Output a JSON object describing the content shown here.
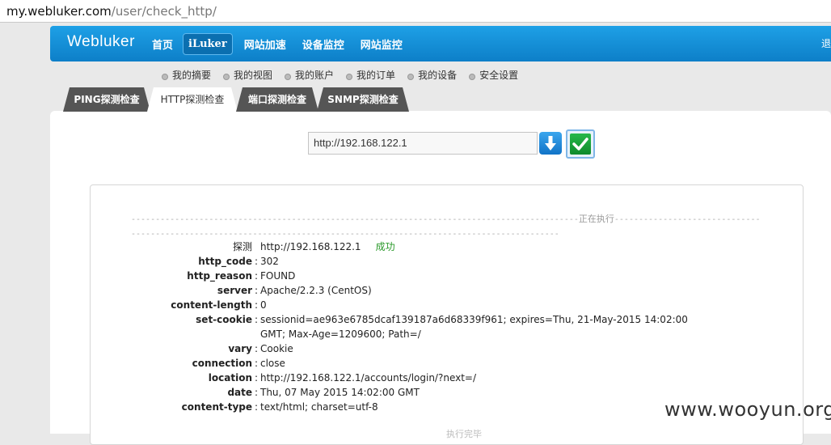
{
  "browser": {
    "url_host": "my.webluker.com",
    "url_path": "/user/check_http/"
  },
  "header": {
    "logo": "Webluker",
    "nav": [
      "首页",
      "iLuker",
      "网站加速",
      "设备监控",
      "网站监控"
    ],
    "active_nav": "iLuker",
    "logout": "退"
  },
  "subnav": [
    "我的摘要",
    "我的视图",
    "我的账户",
    "我的订单",
    "我的设备",
    "安全设置"
  ],
  "tabs": [
    "PING探测检查",
    "HTTP探测检查",
    "端口探测检查",
    "SNMP探测检查"
  ],
  "active_tab": "HTTP探测检查",
  "check": {
    "url_value": "http://192.168.122.1"
  },
  "result": {
    "divider_left": "--------------------------------------------------------------------------------------------",
    "divider_label": "正在执行",
    "divider_right": "----------------------------------------------------------------------------------------------------------------------",
    "probe_label": "探测",
    "probe_target": "http://192.168.122.1",
    "probe_status": "成功",
    "rows": [
      {
        "key": "http_code",
        "value": "302"
      },
      {
        "key": "http_reason",
        "value": "FOUND"
      },
      {
        "key": "server",
        "value": "Apache/2.2.3 (CentOS)"
      },
      {
        "key": "content-length",
        "value": "0"
      },
      {
        "key": "set-cookie",
        "value": "sessionid=ae963e6785dcaf139187a6d68339f961; expires=Thu, 21-May-2015 14:02:00 GMT; Max-Age=1209600; Path=/"
      },
      {
        "key": "vary",
        "value": "Cookie"
      },
      {
        "key": "connection",
        "value": "close"
      },
      {
        "key": "location",
        "value": "http://192.168.122.1/accounts/login/?next=/"
      },
      {
        "key": "date",
        "value": "Thu, 07 May 2015 14:02:00 GMT"
      },
      {
        "key": "content-type",
        "value": "text/html; charset=utf-8"
      }
    ],
    "footer": "执行完毕"
  },
  "watermark": "www.wooyun.org"
}
